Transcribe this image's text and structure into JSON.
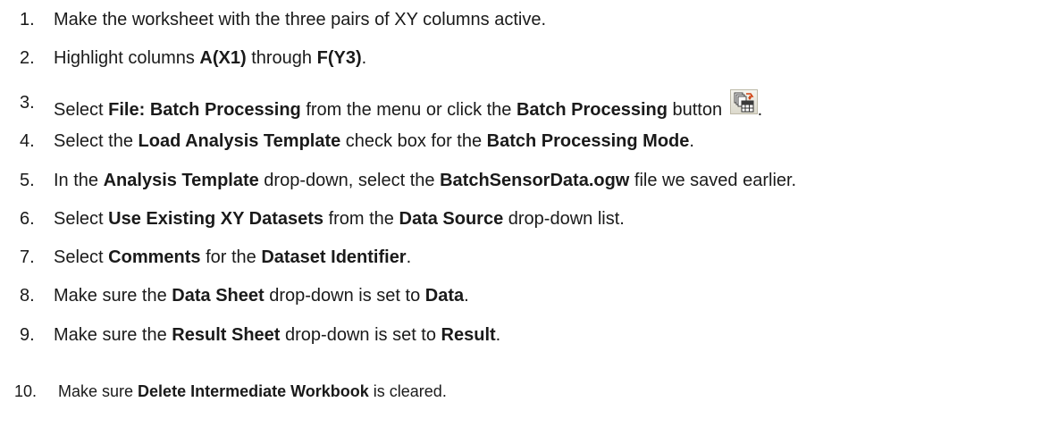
{
  "steps": [
    {
      "num": "1.",
      "parts": [
        "Make the worksheet with the three pairs of XY columns active."
      ]
    },
    {
      "num": "2.",
      "parts": [
        "Highlight columns ",
        "A(X1)",
        " through ",
        "F(Y3)",
        "."
      ]
    },
    {
      "num": "3.",
      "parts": [
        "Select ",
        "File: Batch Processing",
        " from the menu or click the ",
        "Batch Processing",
        " button ",
        "."
      ]
    },
    {
      "num": "4.",
      "parts": [
        "Select the ",
        "Load Analysis Template",
        " check box for the ",
        "Batch Processing Mode",
        "."
      ]
    },
    {
      "num": "5.",
      "parts": [
        "In the ",
        "Analysis Template",
        " drop-down, select the ",
        "BatchSensorData.ogw",
        " file we saved earlier."
      ]
    },
    {
      "num": "6.",
      "parts": [
        "Select ",
        "Use Existing XY Datasets",
        " from the ",
        "Data Source",
        " drop-down list."
      ]
    },
    {
      "num": "7.",
      "parts": [
        "Select ",
        "Comments",
        " for the ",
        "Dataset Identifier",
        "."
      ]
    },
    {
      "num": "8.",
      "parts": [
        "Make sure the ",
        "Data Sheet",
        " drop-down is set to ",
        "Data",
        "."
      ]
    },
    {
      "num": "9.",
      "parts": [
        "Make sure the ",
        "Result Sheet",
        " drop-down is set to ",
        "Result",
        "."
      ]
    },
    {
      "num": "10.",
      "parts": [
        "Make sure ",
        "Delete Intermediate Workbook",
        " is cleared."
      ]
    }
  ],
  "icons": {
    "batch_processing_button": "batch-processing-icon"
  }
}
